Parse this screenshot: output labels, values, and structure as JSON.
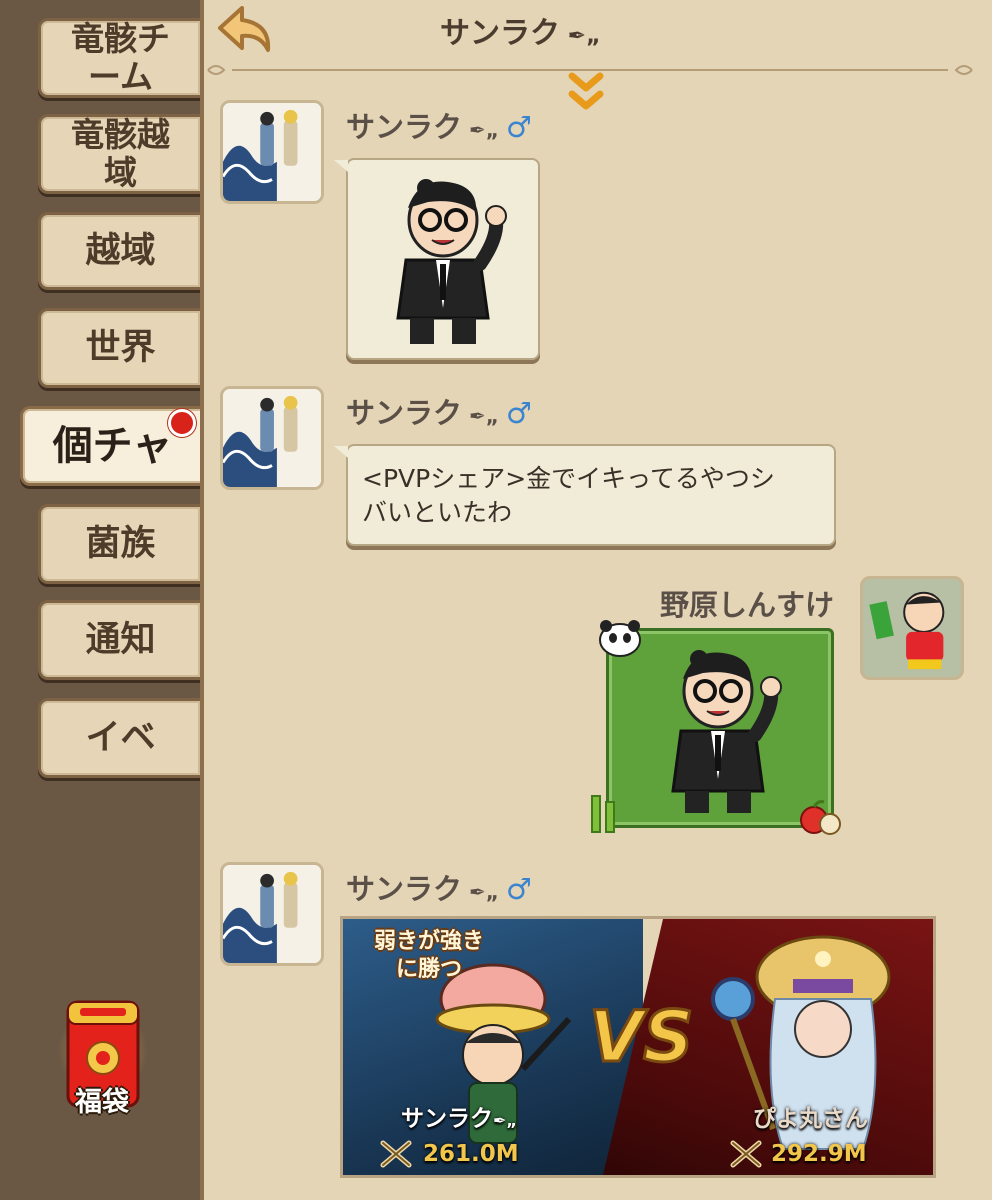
{
  "sidebar": {
    "tabs": [
      {
        "label": "竜骸チーム",
        "active": false,
        "badge": false
      },
      {
        "label": "竜骸越域",
        "active": false,
        "badge": false
      },
      {
        "label": "越域",
        "active": false,
        "badge": false
      },
      {
        "label": "世界",
        "active": false,
        "badge": false
      },
      {
        "label": "個チャ",
        "active": true,
        "badge": true
      },
      {
        "label": "菌族",
        "active": false,
        "badge": false
      },
      {
        "label": "通知",
        "active": false,
        "badge": false
      },
      {
        "label": "イベ",
        "active": false,
        "badge": false
      }
    ],
    "lucky_bag_label": "福袋"
  },
  "header": {
    "title": "サンラク",
    "back_icon": "back-arrow-icon",
    "scroll_icon": "double-chevron-down-icon"
  },
  "messages": [
    {
      "sender": "サンラク",
      "gender": "♂",
      "type": "sticker"
    },
    {
      "sender": "サンラク",
      "gender": "♂",
      "type": "text",
      "text_line1": "<PVPシェア>金でイキってるやつシ",
      "text_line2": "バいといたわ"
    },
    {
      "sender": "野原しんすけ",
      "type": "sticker",
      "own": true
    },
    {
      "sender": "サンラク",
      "gender": "♂",
      "type": "pvp_share"
    }
  ],
  "pvp": {
    "banner_line1": "弱きが強き",
    "banner_line2": "に勝つ",
    "vs_text": "VS",
    "left_name": "サンラク",
    "left_power": "261.0M",
    "right_name": "ぴよ丸さん",
    "right_power": "292.9M"
  },
  "colors": {
    "panel_bg": "#e4d5b6",
    "sidebar_bg": "#6b5844",
    "gender_blue": "#3b84cf",
    "badge_red": "#d8231a"
  }
}
